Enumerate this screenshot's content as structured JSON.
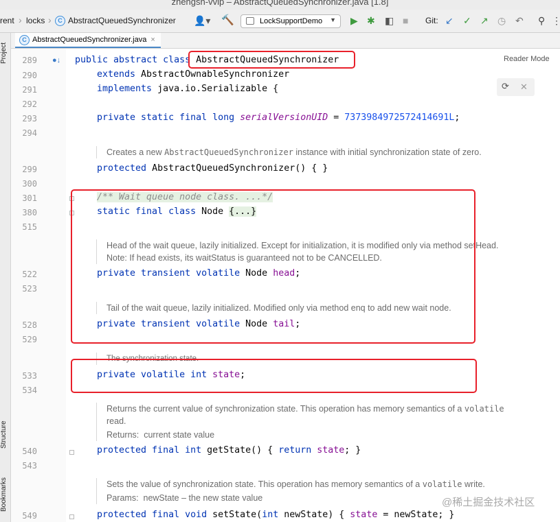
{
  "window": {
    "title": "zhengsh-vvip – AbstractQueuedSynchronizer.java [1.8]"
  },
  "navbar": {
    "crumbs": [
      "rent",
      "locks",
      "AbstractQueuedSynchronizer"
    ],
    "run_config": "LockSupportDemo",
    "git_label": "Git:",
    "icons": [
      "user-icon",
      "hammer-icon",
      "run-icon",
      "debug-icon",
      "coverage-icon",
      "stop-icon",
      "vcs-update-icon",
      "vcs-commit-icon",
      "vcs-push-icon",
      "history-icon",
      "rollback-icon",
      "search-icon"
    ]
  },
  "side_tabs": {
    "project": "Project",
    "structure": "Structure",
    "bookmarks": "Bookmarks"
  },
  "editor": {
    "tab_label": "AbstractQueuedSynchronizer.java",
    "reader_mode": "Reader Mode",
    "lines": [
      {
        "n": "289"
      },
      {
        "n": "290"
      },
      {
        "n": "291"
      },
      {
        "n": "292"
      },
      {
        "n": "293"
      },
      {
        "n": "294"
      },
      {
        "n": "299"
      },
      {
        "n": "300"
      },
      {
        "n": "301"
      },
      {
        "n": "380"
      },
      {
        "n": "515"
      },
      {
        "n": "522"
      },
      {
        "n": "523"
      },
      {
        "n": "528"
      },
      {
        "n": "529"
      },
      {
        "n": "533"
      },
      {
        "n": "534"
      },
      {
        "n": "540"
      },
      {
        "n": "543"
      },
      {
        "n": "549"
      }
    ],
    "code": {
      "l289": [
        "public abstract class ",
        "AbstractQueuedSynchronizer"
      ],
      "l290": [
        "extends ",
        "AbstractOwnableSynchronizer"
      ],
      "l291": [
        "implements ",
        "java.io.Serializable {"
      ],
      "l293": [
        "private static final long ",
        "serialVersionUID",
        " = ",
        "7373984972572414691L",
        ";"
      ],
      "l299": [
        "protected ",
        "AbstractQueuedSynchronizer() { }"
      ],
      "l301": "/** Wait queue node class. ...*/",
      "l380": [
        "static final class ",
        "Node ",
        "{...}"
      ],
      "l522": [
        "private transient volatile ",
        "Node ",
        "head",
        ";"
      ],
      "l528": [
        "private transient volatile ",
        "Node ",
        "tail",
        ";"
      ],
      "l533": [
        "private volatile int ",
        "state",
        ";"
      ],
      "l540": [
        "protected final int ",
        "getState() { ",
        "return ",
        "state",
        "; }"
      ],
      "l549": [
        "protected final void ",
        "setState(",
        "int ",
        "newState) { ",
        "state",
        " = newState; }"
      ]
    },
    "docs": {
      "d_ctor": [
        "Creates a new ",
        "AbstractQueuedSynchronizer",
        " instance with initial synchronization state of zero."
      ],
      "d_head": [
        "Head of the wait queue, lazily initialized. Except for initialization, it is modified only via method setHead.",
        "Note: If head exists, its waitStatus is guaranteed not to be CANCELLED."
      ],
      "d_tail": "Tail of the wait queue, lazily initialized. Modified only via method enq to add new wait node.",
      "d_state": "The synchronization state.",
      "d_getstate": [
        "Returns the current value of synchronization state. This operation has memory semantics of a ",
        "volatile",
        "read.",
        "Returns:",
        "current state value"
      ],
      "d_setstate": [
        "Sets the value of synchronization state. This operation has memory semantics of a ",
        "volatile",
        " write.",
        "Params:",
        "newState – the new state value"
      ]
    }
  },
  "watermark": "@稀土掘金技术社区",
  "colors": {
    "highlight_box": "#e8202a",
    "keyword": "#0033b3",
    "field": "#871094",
    "number": "#1750eb"
  }
}
